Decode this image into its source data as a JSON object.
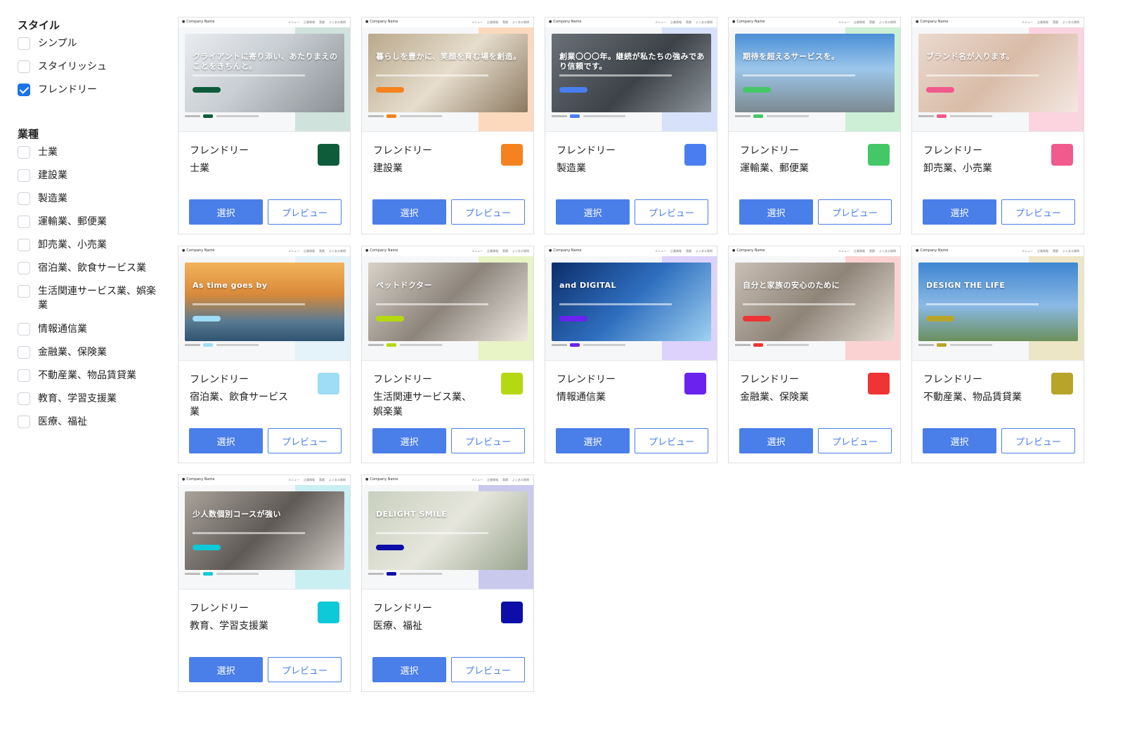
{
  "filters": {
    "style": {
      "title": "スタイル",
      "options": [
        {
          "label": "シンプル",
          "checked": false
        },
        {
          "label": "スタイリッシュ",
          "checked": false
        },
        {
          "label": "フレンドリー",
          "checked": true
        }
      ]
    },
    "industry": {
      "title": "業種",
      "options": [
        {
          "label": "士業",
          "checked": false
        },
        {
          "label": "建設業",
          "checked": false
        },
        {
          "label": "製造業",
          "checked": false
        },
        {
          "label": "運輸業、郵便業",
          "checked": false
        },
        {
          "label": "卸売業、小売業",
          "checked": false
        },
        {
          "label": "宿泊業、飲食サービス業",
          "checked": false
        },
        {
          "label": "生活関連サービス業、娯楽業",
          "checked": false
        },
        {
          "label": "情報通信業",
          "checked": false
        },
        {
          "label": "金融業、保険業",
          "checked": false
        },
        {
          "label": "不動産業、物品賃貸業",
          "checked": false
        },
        {
          "label": "教育、学習支援業",
          "checked": false
        },
        {
          "label": "医療、福祉",
          "checked": false
        }
      ]
    }
  },
  "thumbnail": {
    "company": "Company Name",
    "nav": [
      "メニュー",
      "企業情報",
      "実績",
      "よくある質問"
    ]
  },
  "buttons": {
    "select": "選択",
    "preview": "プレビュー"
  },
  "cards": [
    {
      "style": "フレンドリー",
      "industry": "士業",
      "color": "#0e5c3a",
      "accent": "#cfe3dc",
      "hero_title": "クライアントに寄り添い、あたりまえのことをきちんと。",
      "hero_bg": "linear-gradient(135deg,#e9ecef 0%,#c9ced3 45%,#8a8f94 100%)"
    },
    {
      "style": "フレンドリー",
      "industry": "建設業",
      "color": "#f5821f",
      "accent": "#fcd9bd",
      "hero_title": "暮らしを豊かに、笑顔を育む場を創造。",
      "hero_bg": "linear-gradient(135deg,#b9a88c 0%,#e6ddcc 50%,#8c7a62 100%)"
    },
    {
      "style": "フレンドリー",
      "industry": "製造業",
      "color": "#4a7ef0",
      "accent": "#d7e2fa",
      "hero_title": "創業〇〇〇年。継続が私たちの強みであり信頼です。",
      "hero_bg": "linear-gradient(135deg,#6b7178 0%,#3c4248 55%,#8e959c 100%)"
    },
    {
      "style": "フレンドリー",
      "industry": "運輸業、郵便業",
      "color": "#44c766",
      "accent": "#ccefd6",
      "hero_title": "期待を超えるサービスを。",
      "hero_bg": "linear-gradient(180deg,#4a8fd6 0%,#9cc6ea 45%,#7c8a90 100%)"
    },
    {
      "style": "フレンドリー",
      "industry": "卸売業、小売業",
      "color": "#f05a8c",
      "accent": "#fbd4e0",
      "hero_title": "ブランド名が入ります。",
      "hero_bg": "linear-gradient(135deg,#ead9cf 0%,#d9bca8 50%,#f3e8e2 100%)"
    },
    {
      "style": "フレンドリー",
      "industry": "宿泊業、飲食サービス業",
      "color": "#9fdcf5",
      "accent": "#e4f3fa",
      "hero_title": "As time goes by",
      "hero_bg": "linear-gradient(180deg,#f2b35a 0%,#d98a3a 40%,#5a7a92 75%,#2f5370 100%)"
    },
    {
      "style": "フレンドリー",
      "industry": "生活関連サービス業、娯楽業",
      "color": "#b5d90f",
      "accent": "#e8f3c6",
      "hero_title": "ペットドクター",
      "hero_bg": "linear-gradient(135deg,#d9d2c9 0%,#8d857c 50%,#eee8e1 100%)"
    },
    {
      "style": "フレンドリー",
      "industry": "情報通信業",
      "color": "#6a22ee",
      "accent": "#ddd2fb",
      "hero_title": "and DIGITAL",
      "hero_bg": "linear-gradient(135deg,#0d2e6b 0%,#2f6fbf 50%,#9fd1f2 100%)"
    },
    {
      "style": "フレンドリー",
      "industry": "金融業、保険業",
      "color": "#ee3434",
      "accent": "#fbd2d2",
      "hero_title": "自分と家族の安心のために",
      "hero_bg": "linear-gradient(135deg,#c9bfb5 0%,#8f8478 50%,#e7dfd6 100%)"
    },
    {
      "style": "フレンドリー",
      "industry": "不動産業、物品賃貸業",
      "color": "#b7a52a",
      "accent": "#ece6c6",
      "hero_title": "DESIGN THE LIFE",
      "hero_bg": "linear-gradient(180deg,#3f86d1 0%,#8ab9e5 55%,#6c8f5c 100%)"
    },
    {
      "style": "フレンドリー",
      "industry": "教育、学習支援業",
      "color": "#0ec9d8",
      "accent": "#c9eff3",
      "hero_title": "少人数個別コースが強い",
      "hero_bg": "linear-gradient(135deg,#a9a39b 0%,#5f5a55 50%,#d2cdc6 100%)"
    },
    {
      "style": "フレンドリー",
      "industry": "医療、福祉",
      "color": "#0d0da8",
      "accent": "#c9c9ee",
      "hero_title": "DELIGHT SMILE",
      "hero_bg": "linear-gradient(135deg,#c9d0bf 0%,#e6e6dc 50%,#9aa48f 100%)"
    }
  ]
}
